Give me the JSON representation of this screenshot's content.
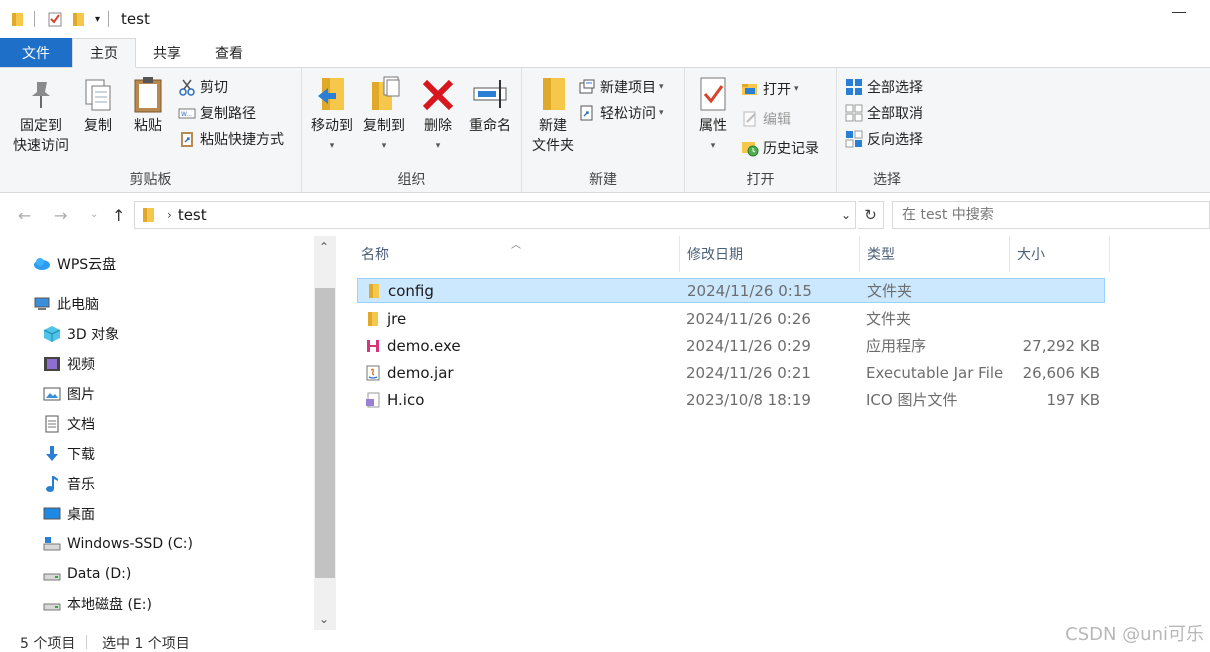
{
  "window": {
    "title": "test"
  },
  "ribbon_tabs": [
    "文件",
    "主页",
    "共享",
    "查看"
  ],
  "clipboard_group": {
    "label": "剪贴板",
    "pin_line1": "固定到",
    "pin_line2": "快速访问",
    "copy": "复制",
    "paste": "粘贴",
    "cut": "剪切",
    "copy_path": "复制路径",
    "paste_shortcut": "粘贴快捷方式"
  },
  "organize_group": {
    "label": "组织",
    "move_to": "移动到",
    "copy_to": "复制到",
    "delete": "删除",
    "rename": "重命名"
  },
  "new_group": {
    "label": "新建",
    "new_folder_line1": "新建",
    "new_folder_line2": "文件夹",
    "new_item": "新建项目",
    "easy_access": "轻松访问"
  },
  "open_group": {
    "label": "打开",
    "properties": "属性",
    "open": "打开",
    "edit": "编辑",
    "history": "历史记录"
  },
  "select_group": {
    "label": "选择",
    "select_all": "全部选择",
    "select_none": "全部取消",
    "invert": "反向选择"
  },
  "address": {
    "path": "test",
    "search_placeholder": "在 test 中搜索"
  },
  "sidebar": {
    "items": [
      {
        "label": "WPS云盘",
        "icon": "cloud-icon"
      },
      {
        "label": "此电脑",
        "icon": "computer-icon"
      },
      {
        "label": "3D 对象",
        "icon": "cube-icon"
      },
      {
        "label": "视频",
        "icon": "video-icon"
      },
      {
        "label": "图片",
        "icon": "picture-icon"
      },
      {
        "label": "文档",
        "icon": "document-icon"
      },
      {
        "label": "下载",
        "icon": "download-icon"
      },
      {
        "label": "音乐",
        "icon": "music-icon"
      },
      {
        "label": "桌面",
        "icon": "desktop-icon"
      },
      {
        "label": "Windows-SSD (C:)",
        "icon": "drive-icon"
      },
      {
        "label": "Data (D:)",
        "icon": "drive-icon"
      },
      {
        "label": "本地磁盘 (E:)",
        "icon": "drive-icon"
      }
    ]
  },
  "columns": {
    "name": "名称",
    "modified": "修改日期",
    "type": "类型",
    "size": "大小"
  },
  "files": [
    {
      "name": "config",
      "modified": "2024/11/26 0:15",
      "type": "文件夹",
      "size": "",
      "icon": "folder-icon"
    },
    {
      "name": "jre",
      "modified": "2024/11/26 0:26",
      "type": "文件夹",
      "size": "",
      "icon": "folder-icon"
    },
    {
      "name": "demo.exe",
      "modified": "2024/11/26 0:29",
      "type": "应用程序",
      "size": "27,292 KB",
      "icon": "exe-icon"
    },
    {
      "name": "demo.jar",
      "modified": "2024/11/26 0:21",
      "type": "Executable Jar File",
      "size": "26,606 KB",
      "icon": "jar-icon"
    },
    {
      "name": "H.ico",
      "modified": "2023/10/8 18:19",
      "type": "ICO 图片文件",
      "size": "197 KB",
      "icon": "ico-file-icon"
    }
  ],
  "status": {
    "count": "5 个项目",
    "selected": "选中 1 个项目"
  },
  "watermark": "CSDN @uni可乐",
  "colors": {
    "accent": "#1e6fc8",
    "selection": "#cce8ff",
    "folder": "#f5c84c"
  }
}
